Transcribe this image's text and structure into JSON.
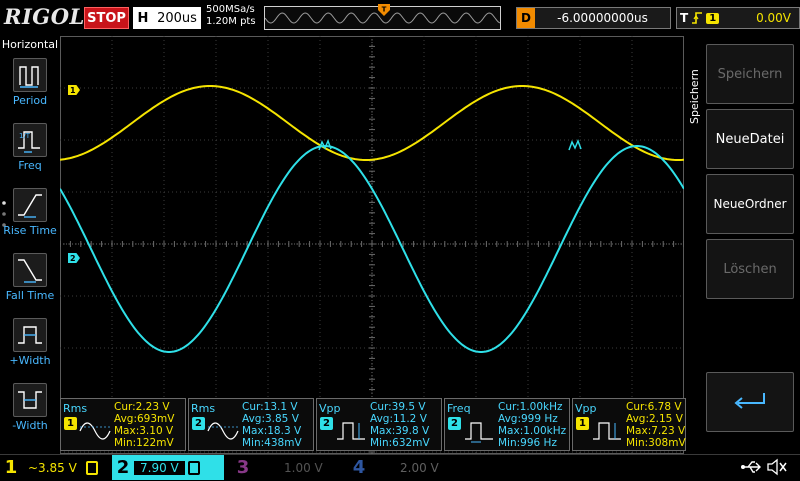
{
  "topbar": {
    "brand": "RIGOL",
    "run_state": "STOP",
    "timebase_label": "H",
    "timebase_value": "200us",
    "sample_rate": "500MSa/s",
    "memory_depth": "1.20M pts",
    "delay_label": "D",
    "delay_value": "-6.00000000us",
    "trigger_label": "T",
    "trigger_source": "1",
    "trigger_level": "0.00V"
  },
  "left_panel": {
    "title": "Horizontal",
    "items": [
      {
        "label": "Period"
      },
      {
        "label": "Freq"
      },
      {
        "label": "Rise Time"
      },
      {
        "label": "Fall Time"
      },
      {
        "label": "+Width"
      },
      {
        "label": "-Width"
      }
    ]
  },
  "channel_markers": {
    "ch1": "1",
    "ch2": "2"
  },
  "measurements": [
    {
      "name": "Rms",
      "channel": "1",
      "ch_class": "ch1",
      "cur": "Cur:2.23 V",
      "avg": "Avg:693mV",
      "max": "Max:3.10 V",
      "min": "Min:122mV"
    },
    {
      "name": "Rms",
      "channel": "2",
      "ch_class": "ch2",
      "cur": "Cur:13.1 V",
      "avg": "Avg:3.85 V",
      "max": "Max:18.3 V",
      "min": "Min:438mV"
    },
    {
      "name": "Vpp",
      "channel": "2",
      "ch_class": "ch2",
      "cur": "Cur:39.5 V",
      "avg": "Avg:11.2 V",
      "max": "Max:39.8 V",
      "min": "Min:632mV"
    },
    {
      "name": "Freq",
      "channel": "2",
      "ch_class": "ch2",
      "cur": "Cur:1.00kHz",
      "avg": "Avg:999 Hz",
      "max": "Max:1.00kHz",
      "min": "Min:996 Hz"
    },
    {
      "name": "Vpp",
      "channel": "1",
      "ch_class": "ch1",
      "cur": "Cur:6.78 V",
      "avg": "Avg:2.15 V",
      "max": "Max:7.23 V",
      "min": "Min:308mV"
    }
  ],
  "right_panel": {
    "tab_label": "Speichern",
    "buttons": [
      {
        "label": "Speichern",
        "enabled": false
      },
      {
        "label": "NeueDatei",
        "enabled": true
      },
      {
        "label": "NeueOrdner",
        "enabled": true
      },
      {
        "label": "Löschen",
        "enabled": false
      }
    ]
  },
  "bottombar": {
    "channels": [
      {
        "num": "1",
        "value": "~3.85 V",
        "active": true
      },
      {
        "num": "2",
        "value": "7.90 V",
        "active": true
      },
      {
        "num": "3",
        "value": "1.00 V",
        "active": false
      },
      {
        "num": "4",
        "value": "2.00 V",
        "active": false
      }
    ]
  },
  "colors": {
    "ch1": "#f5e400",
    "ch2": "#2fe0e8",
    "ch3": "#c050c0",
    "ch4": "#3a6cc8",
    "accent_orange": "#f28b00",
    "stop_red": "#c8141a",
    "label_blue": "#49b8ff",
    "grid": "#3d3d3d"
  },
  "icons": {
    "trigger_edge": "rising-edge-icon",
    "usb": "usb-icon",
    "speaker": "speaker-muted-icon",
    "return": "return-arrow-icon"
  }
}
